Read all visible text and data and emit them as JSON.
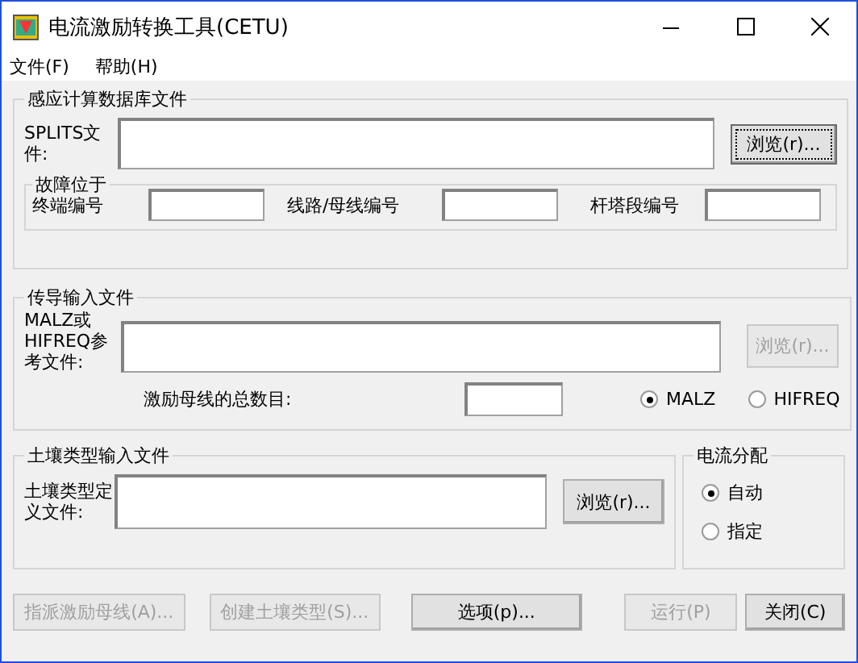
{
  "window": {
    "title": "电流激励转换工具(CETU)"
  },
  "menu": [
    {
      "label": "文件(F)"
    },
    {
      "label": "帮助(H)"
    }
  ],
  "database_group": {
    "title": "感应计算数据库文件",
    "file_label": "SPLITS文件:",
    "browse_button": {
      "label": "浏览(r)...",
      "disabled": false,
      "focused": true
    },
    "fault_group": {
      "title": "故障位于",
      "fields": [
        {
          "label": "终端编号"
        },
        {
          "label": "线路/母线编号"
        },
        {
          "label": "杆塔段编号"
        }
      ]
    }
  },
  "conduction_group": {
    "title": "传导输入文件",
    "file_label": "MALZ或HIFREQ参考文件:",
    "browse_button": {
      "label": "浏览(r)...",
      "disabled": true,
      "focused": false
    },
    "count_label": "激励母线的总数目:",
    "radios": [
      {
        "label": "MALZ",
        "selected": true
      },
      {
        "label": "HIFREQ",
        "selected": false
      }
    ]
  },
  "soil_group": {
    "title": "土壤类型输入文件",
    "file_label": "土壤类型定义文件:",
    "browse_button": {
      "label": "浏览(r)...",
      "disabled": false,
      "focused": false
    }
  },
  "distribution_group": {
    "title": "电流分配",
    "radios": [
      {
        "label": "自动",
        "selected": true
      },
      {
        "label": "指定",
        "selected": false
      }
    ]
  },
  "buttons": [
    {
      "label": "指派激励母线(A)...",
      "disabled": true
    },
    {
      "label": "创建土壤类型(S)...",
      "disabled": true
    },
    {
      "label": "选项(p)...",
      "disabled": false
    },
    {
      "label": "运行(P)",
      "disabled": true
    },
    {
      "label": "关闭(C)",
      "disabled": false
    }
  ]
}
